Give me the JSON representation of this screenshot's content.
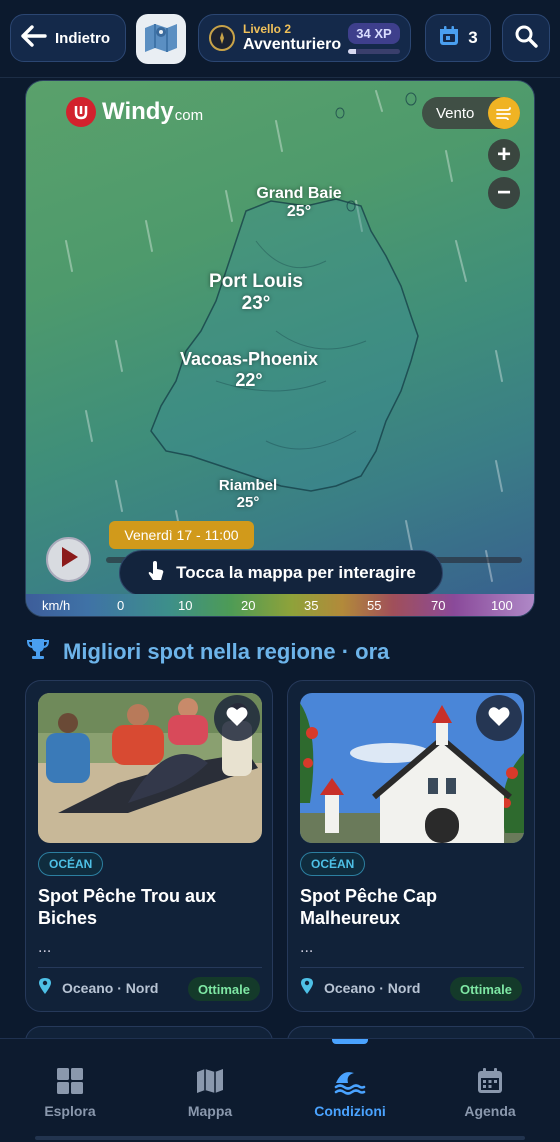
{
  "header": {
    "back_label": "Indietro",
    "level_title": "Livello 2",
    "level_name": "Avventuriero",
    "xp_label": "34 XP",
    "xp_progress": 0.15,
    "calendar_count": "3",
    "icons": [
      "arrow-left-icon",
      "map-icon",
      "compass-icon",
      "calendar-icon",
      "search-icon"
    ]
  },
  "map": {
    "brand": "Windy",
    "brand_suffix": "com",
    "layer_label": "Vento",
    "zoom_in": "+",
    "zoom_out": "−",
    "cities": [
      {
        "name": "Grand Baie",
        "temp": "25°"
      },
      {
        "name": "Port Louis",
        "temp": "23°"
      },
      {
        "name": "Vacoas-Phoenix",
        "temp": "22°"
      },
      {
        "name": "Riambel",
        "temp": "25°"
      }
    ],
    "date_label": "Venerdì 17 - 11:00",
    "interact_hint": "Tocca la mappa per interagire",
    "scale_unit": "km/h",
    "scale_ticks": [
      "0",
      "10",
      "20",
      "35",
      "55",
      "70",
      "100"
    ]
  },
  "section": {
    "title": "Migliori spot nella regione · ora"
  },
  "spots": [
    {
      "tag": "OCÉAN",
      "title": "Spot Pêche Trou aux Biches",
      "desc": "...",
      "location": "Oceano · Nord",
      "status": "Ottimale"
    },
    {
      "tag": "OCÉAN",
      "title": "Spot Pêche Cap Malheureux",
      "desc": "...",
      "location": "Oceano · Nord",
      "status": "Ottimale"
    }
  ],
  "nav": [
    {
      "label": "Esplora",
      "icon": "grid-icon"
    },
    {
      "label": "Mappa",
      "icon": "map-icon"
    },
    {
      "label": "Condizioni",
      "icon": "waves-icon",
      "active": true
    },
    {
      "label": "Agenda",
      "icon": "calendar-icon"
    }
  ],
  "colors": {
    "accent": "#4aa3ff",
    "section_title": "#6db4ea",
    "status_good": "#7ee7a4",
    "windy_red": "#d2222d",
    "date_tag": "#d19a1b"
  }
}
